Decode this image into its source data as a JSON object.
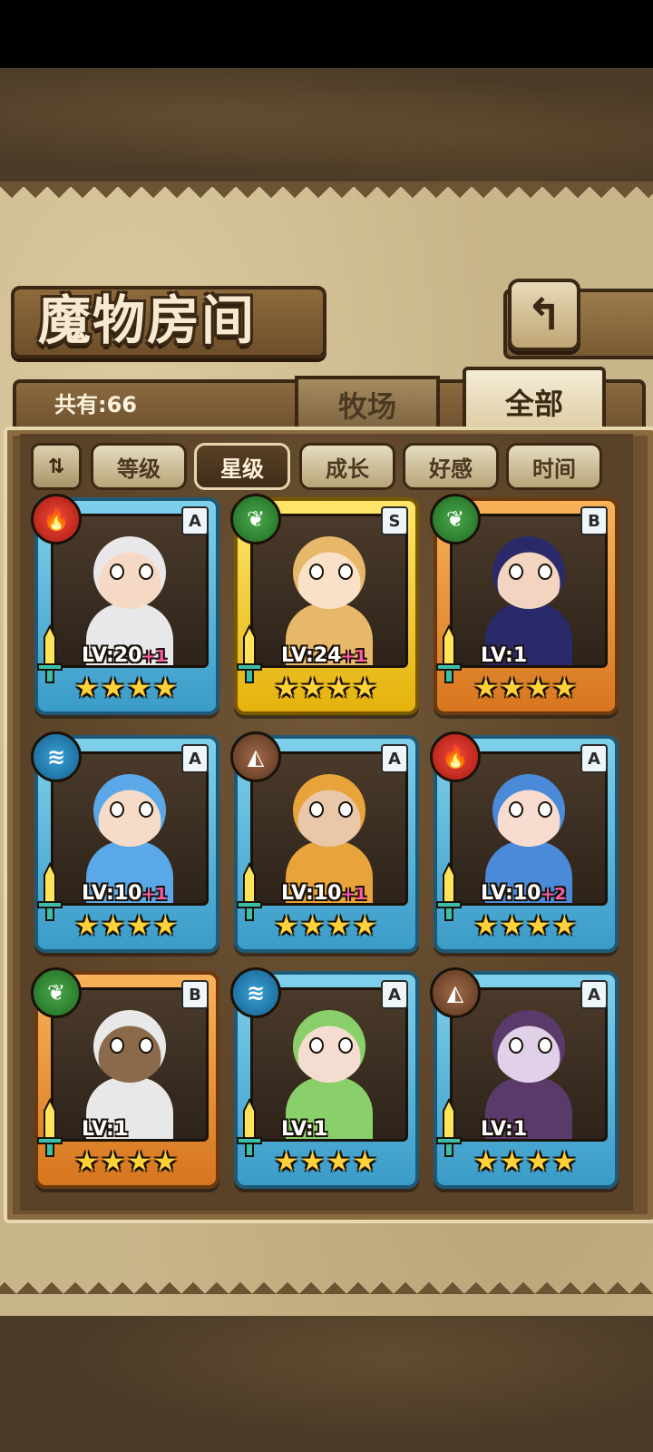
{
  "header": {
    "title": "魔物房间",
    "back_icon": "back-arrow-icon"
  },
  "tabs": {
    "count_label": "共有:66",
    "farm": "牧场",
    "all": "全部"
  },
  "filters": {
    "toggle_icon": "sort-toggle-icon",
    "items": [
      "等级",
      "星级",
      "成长",
      "好感",
      "时间"
    ],
    "active": "星级"
  },
  "monsters": [
    {
      "rank": "A",
      "element": "fire",
      "level": "LV:20",
      "bonus": "+1",
      "stars": 4,
      "color": "#3a9cc8"
    },
    {
      "rank": "S",
      "element": "leaf",
      "level": "LV:24",
      "bonus": "+1",
      "stars": 4,
      "color": "#e4b20c"
    },
    {
      "rank": "B",
      "element": "leaf",
      "level": "LV:1",
      "bonus": "",
      "stars": 4,
      "color": "#d7761e"
    },
    {
      "rank": "A",
      "element": "water",
      "level": "LV:10",
      "bonus": "+1",
      "stars": 4,
      "color": "#3a9cc8"
    },
    {
      "rank": "A",
      "element": "earth",
      "level": "LV:10",
      "bonus": "+1",
      "stars": 4,
      "color": "#3a9cc8"
    },
    {
      "rank": "A",
      "element": "fire",
      "level": "LV:10",
      "bonus": "+2",
      "stars": 4,
      "color": "#3a9cc8"
    },
    {
      "rank": "B",
      "element": "leaf",
      "level": "LV:1",
      "bonus": "",
      "stars": 4,
      "color": "#d7761e"
    },
    {
      "rank": "A",
      "element": "water",
      "level": "LV:1",
      "bonus": "",
      "stars": 4,
      "color": "#3a9cc8"
    },
    {
      "rank": "A",
      "element": "earth",
      "level": "LV:1",
      "bonus": "",
      "stars": 4,
      "color": "#3a9cc8"
    }
  ]
}
